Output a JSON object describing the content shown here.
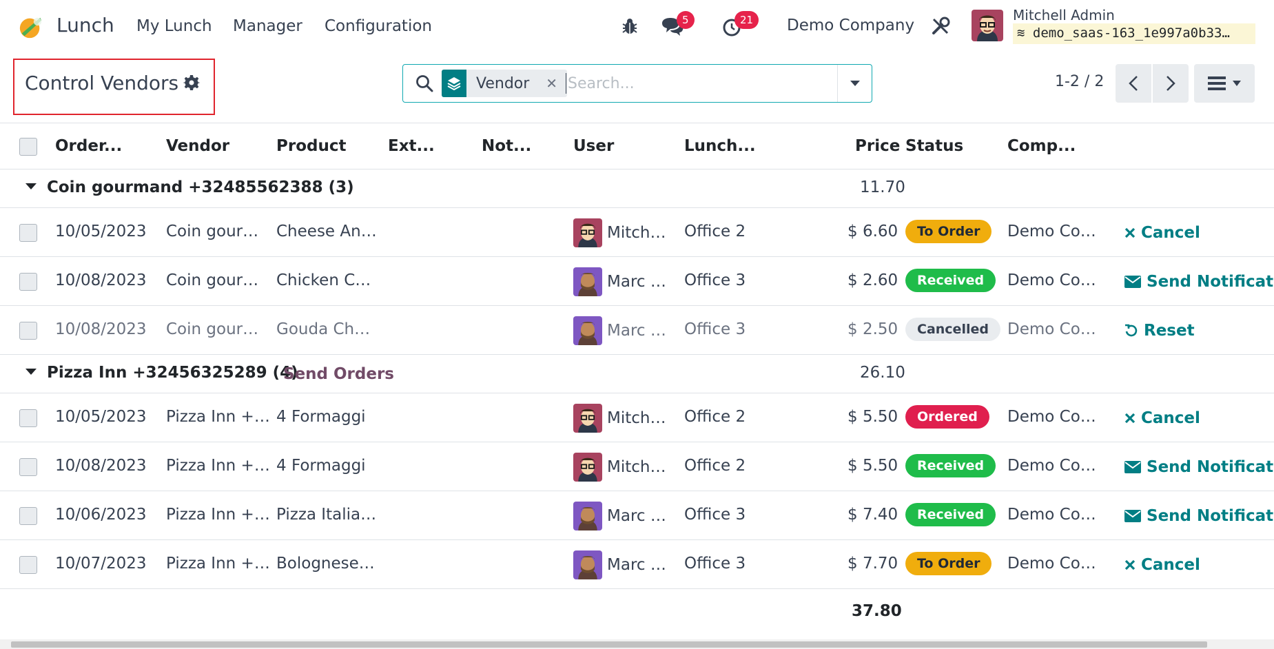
{
  "navbar": {
    "app_name": "Lunch",
    "menu": [
      "My Lunch",
      "Manager",
      "Configuration"
    ],
    "messages_count": "5",
    "activities_count": "21",
    "company": "Demo Company",
    "user_name": "Mitchell Admin",
    "database": "demo_saas-163_1e997a0b33…"
  },
  "control_panel": {
    "title": "Control Vendors",
    "facet_label": "Vendor",
    "search_placeholder": "Search...",
    "pager": "1-2 / 2"
  },
  "columns": [
    "Order...",
    "Vendor",
    "Product",
    "Ext...",
    "Not...",
    "User",
    "Lunch...",
    "Price",
    "Status",
    "Comp..."
  ],
  "groups": [
    {
      "title": "Coin gourmand +32485562388 (3)",
      "total": "11.70",
      "button": "",
      "rows": [
        {
          "date": "10/05/2023",
          "vendor": "Coin gour…",
          "product": "Cheese An…",
          "user": "Mitch…",
          "avatar": "mitchell",
          "location": "Office 2",
          "price": "$ 6.60",
          "status": "To Order",
          "status_style": "warning",
          "company": "Demo Co…",
          "action": "Cancel",
          "action_icon": "cancel-icon",
          "muted": false
        },
        {
          "date": "10/08/2023",
          "vendor": "Coin gour…",
          "product": "Chicken C…",
          "user": "Marc …",
          "avatar": "marc",
          "location": "Office 3",
          "price": "$ 2.60",
          "status": "Received",
          "status_style": "success",
          "company": "Demo Co…",
          "action": "Send Notificatio",
          "action_icon": "envelope-icon",
          "muted": false
        },
        {
          "date": "10/08/2023",
          "vendor": "Coin gour…",
          "product": "Gouda Ch…",
          "user": "Marc …",
          "avatar": "marc",
          "location": "Office 3",
          "price": "$ 2.50",
          "status": "Cancelled",
          "status_style": "muted",
          "company": "Demo Co…",
          "action": "Reset",
          "action_icon": "reset-icon",
          "muted": true
        }
      ]
    },
    {
      "title": "Pizza Inn +32456325289 (4)",
      "total": "26.10",
      "button": "Send Orders",
      "rows": [
        {
          "date": "10/05/2023",
          "vendor": "Pizza Inn +…",
          "product": "4 Formaggi",
          "user": "Mitch…",
          "avatar": "mitchell",
          "location": "Office 2",
          "price": "$ 5.50",
          "status": "Ordered",
          "status_style": "danger",
          "company": "Demo Co…",
          "action": "Cancel",
          "action_icon": "cancel-icon",
          "muted": false
        },
        {
          "date": "10/08/2023",
          "vendor": "Pizza Inn +…",
          "product": "4 Formaggi",
          "user": "Mitch…",
          "avatar": "mitchell",
          "location": "Office 2",
          "price": "$ 5.50",
          "status": "Received",
          "status_style": "success",
          "company": "Demo Co…",
          "action": "Send Notificatio",
          "action_icon": "envelope-icon",
          "muted": false
        },
        {
          "date": "10/06/2023",
          "vendor": "Pizza Inn +…",
          "product": "Pizza Italia…",
          "user": "Marc …",
          "avatar": "marc",
          "location": "Office 3",
          "price": "$ 7.40",
          "status": "Received",
          "status_style": "success",
          "company": "Demo Co…",
          "action": "Send Notificatio",
          "action_icon": "envelope-icon",
          "muted": false
        },
        {
          "date": "10/07/2023",
          "vendor": "Pizza Inn +…",
          "product": "Bolognese…",
          "user": "Marc …",
          "avatar": "marc",
          "location": "Office 3",
          "price": "$ 7.70",
          "status": "To Order",
          "status_style": "warning",
          "company": "Demo Co…",
          "action": "Cancel",
          "action_icon": "cancel-icon",
          "muted": false
        }
      ]
    }
  ],
  "grand_total": "37.80",
  "colors": {
    "accent": "#017e84",
    "brand": "#714b67",
    "highlight_box": "#e0242d"
  }
}
